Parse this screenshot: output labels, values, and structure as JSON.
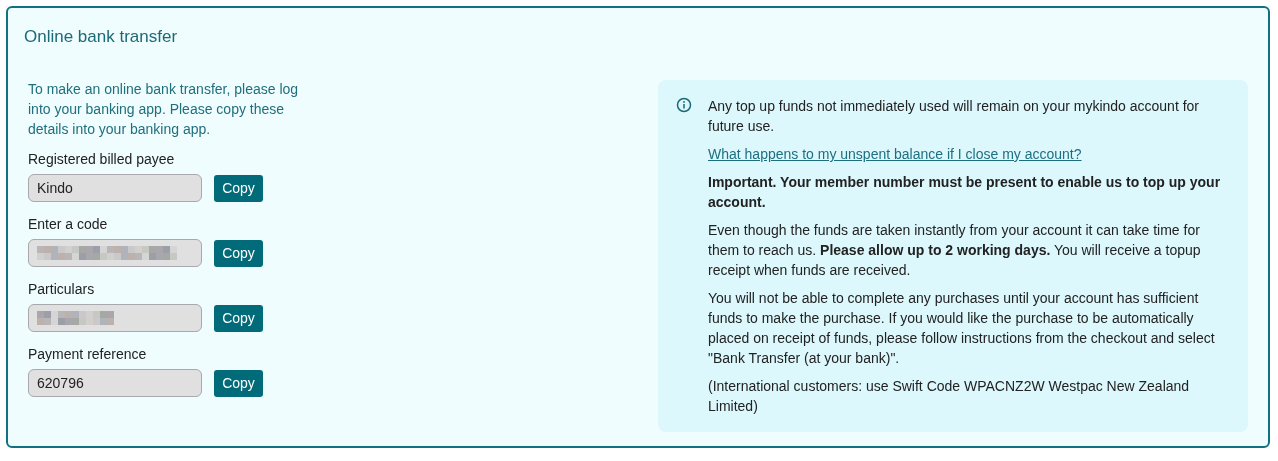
{
  "title": "Online bank transfer",
  "intro": "To make an online bank transfer, please log into your banking app. Please copy these details into your banking app.",
  "fields": [
    {
      "label": "Registered billed payee",
      "value": "Kindo",
      "redacted": false,
      "button": "Copy"
    },
    {
      "label": "Enter a code",
      "redacted": true,
      "button": "Copy"
    },
    {
      "label": "Particulars",
      "redacted": true,
      "button": "Copy"
    },
    {
      "label": "Payment reference",
      "value": "620796",
      "redacted": false,
      "button": "Copy"
    }
  ],
  "info": {
    "paragraphs": [
      {
        "kind": "text",
        "text": "Any top up funds not immediately used will remain on your mykindo account for future use."
      },
      {
        "kind": "link",
        "text": "What happens to my unspent balance if I close my account?"
      },
      {
        "kind": "strong",
        "text": "Important. Your member number must be present to enable us to top up your account."
      },
      {
        "kind": "text",
        "text": "Even though the funds are taken instantly from your account it can take time for them to reach us. **Please allow up to 2 working days.** You will receive a topup receipt when funds are received."
      },
      {
        "kind": "text",
        "text": "You will not be able to complete any purchases until your account has sufficient funds to make the purchase. If you would like the purchase to be automatically placed on receipt of funds, please follow instructions from the checkout and select \"Bank Transfer (at your bank)\"."
      },
      {
        "kind": "text",
        "text": "(International customers: use Swift Code WPACNZ2W Westpac New Zealand Limited)"
      }
    ]
  }
}
